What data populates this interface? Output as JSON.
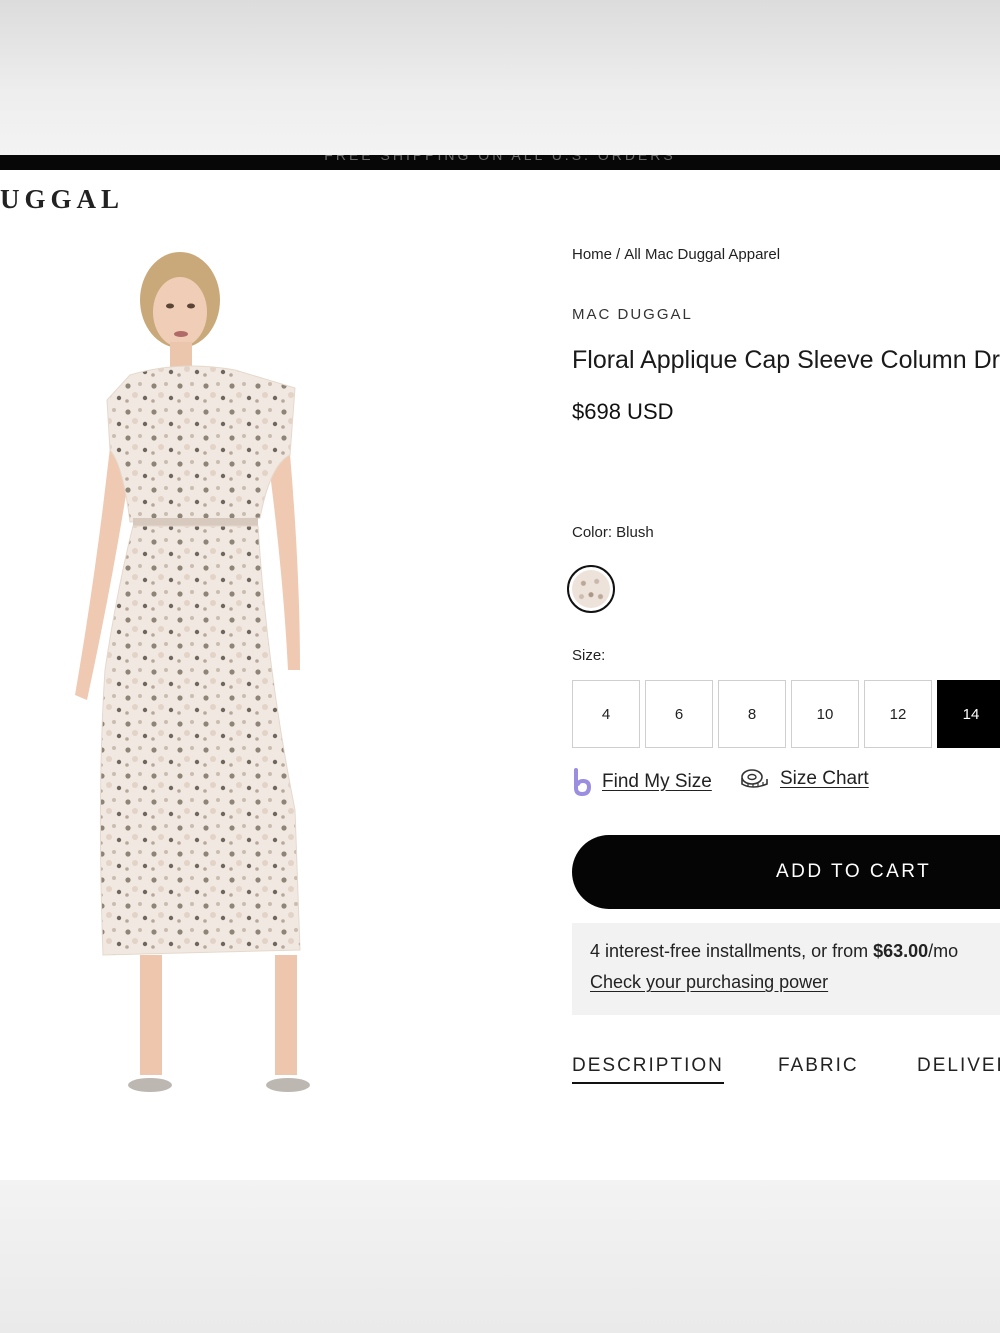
{
  "header": {
    "logo": "UGGAL",
    "announcement": "FREE SHIPPING ON ALL U.S. ORDERS"
  },
  "breadcrumb": {
    "home": "Home",
    "separator": "/",
    "current": "All Mac Duggal Apparel"
  },
  "product": {
    "brand": "MAC DUGGAL",
    "title": "Floral Applique Cap Sleeve Column Dress",
    "price": "$698 USD",
    "color_label": "Color: Blush",
    "size_label": "Size:",
    "sizes": [
      "4",
      "6",
      "8",
      "10",
      "12",
      "14"
    ],
    "selected_size": "14"
  },
  "helpers": {
    "find_my_size": "Find My Size",
    "size_chart": "Size Chart"
  },
  "cart": {
    "add_label": "ADD TO CART"
  },
  "payment": {
    "line1_prefix": "4 interest-free installments, or from ",
    "amount": "$63.00",
    "line1_suffix": "/mo",
    "link": "Check your purchasing power"
  },
  "tabs": [
    "DESCRIPTION",
    "FABRIC",
    "DELIVERY"
  ],
  "colors": {
    "accent": "#000000",
    "selected_size_bg": "#000000",
    "pay_box_bg": "#f2f2f2",
    "find_my_size_icon": "#9b8ee0"
  }
}
